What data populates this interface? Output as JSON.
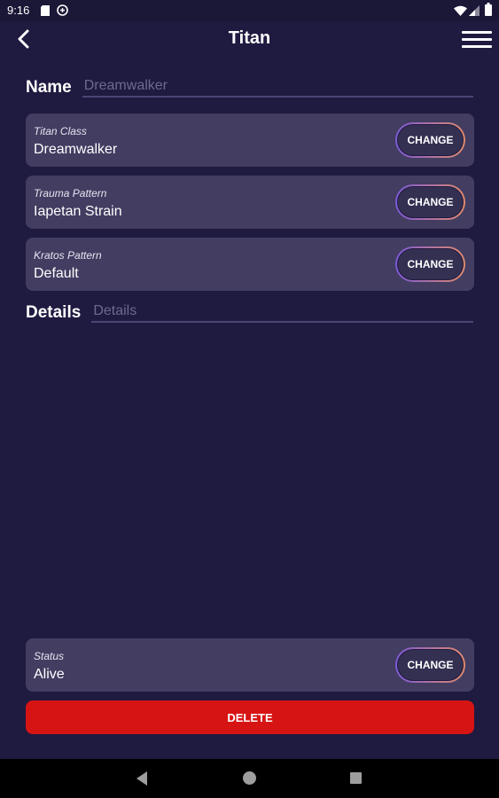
{
  "status_bar": {
    "time": "9:16"
  },
  "app_bar": {
    "title": "Titan"
  },
  "name_field": {
    "label": "Name",
    "value": "",
    "placeholder": "Dreamwalker"
  },
  "cards": [
    {
      "label": "Titan Class",
      "value": "Dreamwalker",
      "button": "CHANGE"
    },
    {
      "label": "Trauma Pattern",
      "value": "Iapetan Strain",
      "button": "CHANGE"
    },
    {
      "label": "Kratos Pattern",
      "value": "Default",
      "button": "CHANGE"
    }
  ],
  "details_field": {
    "label": "Details",
    "value": "",
    "placeholder": "Details"
  },
  "status_card": {
    "label": "Status",
    "value": "Alive",
    "button": "CHANGE"
  },
  "delete_button": {
    "label": "DELETE"
  },
  "colors": {
    "background": "#1f1a40",
    "card": "#423d61",
    "delete": "#d71414",
    "accent_start": "#7d5ad6",
    "accent_end": "#e08a6d"
  }
}
